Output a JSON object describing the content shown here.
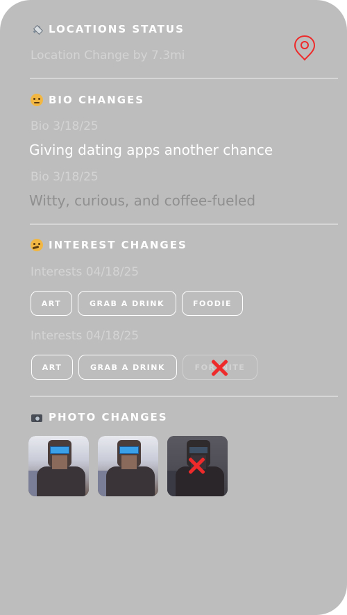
{
  "location": {
    "title": "LOCATIONS STATUS",
    "icon": "satellite-icon",
    "change_text": "Location Change by 7.3mi",
    "pin_icon": "location-pin-icon",
    "pin_color": "#ee2a2a"
  },
  "bio": {
    "title": "BIO CHANGES",
    "icon": "neutral-face-icon",
    "entries": [
      {
        "date": "Bio 3/18/25",
        "text": "Giving dating apps another chance",
        "state": "current"
      },
      {
        "date": "Bio 3/18/25",
        "text": "Witty, curious, and coffee-fueled",
        "state": "previous"
      }
    ]
  },
  "interests": {
    "title": "INTEREST CHANGES",
    "icon": "thinking-face-icon",
    "groups": [
      {
        "date": "Interests 04/18/25",
        "chips": [
          {
            "label": "ART",
            "removed": false
          },
          {
            "label": "GRAB A DRINK",
            "removed": false
          },
          {
            "label": "FOODIE",
            "removed": false
          }
        ]
      },
      {
        "date": "Interests 04/18/25",
        "chips": [
          {
            "label": "ART",
            "removed": false
          },
          {
            "label": "GRAB A DRINK",
            "removed": false
          },
          {
            "label": "FORTNITE",
            "removed": true
          }
        ]
      }
    ]
  },
  "photos": {
    "title": "PHOTO CHANGES",
    "icon": "camera-flash-icon",
    "items": [
      {
        "removed": false
      },
      {
        "removed": false
      },
      {
        "removed": true
      }
    ]
  },
  "colors": {
    "card": "#bdbdbd",
    "removed_mark": "#ee2a2a"
  }
}
